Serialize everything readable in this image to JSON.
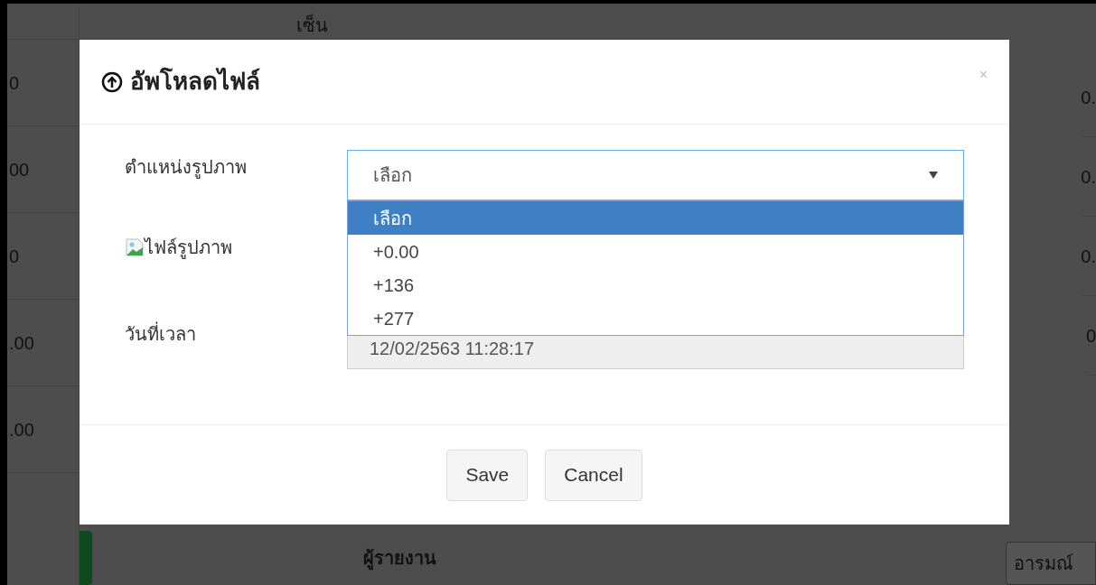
{
  "background": {
    "header_cell": "เซ็น",
    "left_cells": [
      "0",
      "00",
      "0",
      ".00",
      ".00"
    ],
    "right_cells": [
      "0.",
      "0.",
      "0.",
      "0"
    ],
    "footer": {
      "reporter": "ผู้รายงาน",
      "button": "อารมณ์"
    }
  },
  "dialog": {
    "title": "อัพโหลดไฟล์",
    "close": "×",
    "fields": [
      {
        "kind": "select",
        "label": "ตำแหน่งรูปภาพ",
        "value": "เลือก",
        "expanded": true,
        "options": [
          {
            "label": "เลือก",
            "selected": true
          },
          {
            "label": "+0.00",
            "selected": false
          },
          {
            "label": "+136",
            "selected": false
          },
          {
            "label": "+277",
            "selected": false
          }
        ]
      },
      {
        "kind": "file",
        "label": "ไฟล์รูปภาพ"
      },
      {
        "kind": "text",
        "label": "วันที่เวลา",
        "value": "12/02/2563 11:28:17",
        "disabled": true
      }
    ],
    "buttons": [
      "Save",
      "Cancel"
    ]
  }
}
